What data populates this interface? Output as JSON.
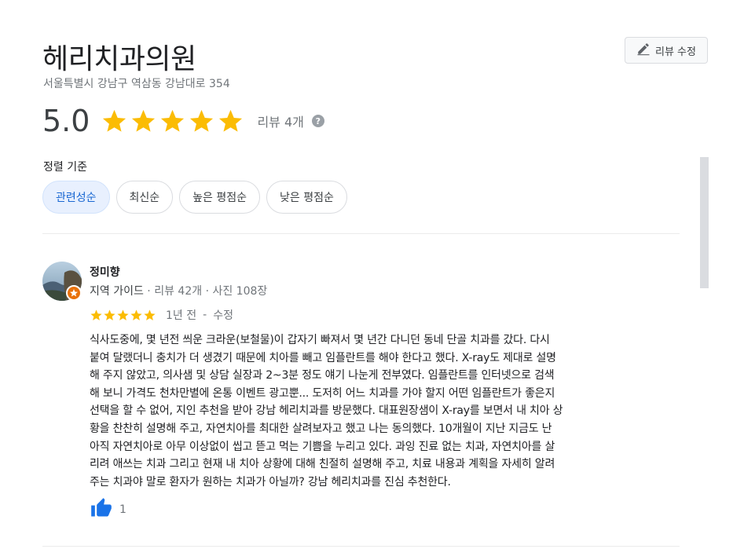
{
  "place": {
    "name": "헤리치과의원",
    "address": "서울특별시 강남구 역삼동 강남대로 354"
  },
  "edit_button": {
    "label": "리뷰 수정"
  },
  "summary": {
    "score": "5.0",
    "stars": 5,
    "review_count": "리뷰 4개",
    "help_icon": "?"
  },
  "sort": {
    "label": "정렬 기준",
    "options": [
      "관련성순",
      "최신순",
      "높은 평점순",
      "낮은 평점순"
    ],
    "selected": "관련성순"
  },
  "reviews": [
    {
      "author": "정미향",
      "guide_label": "지역 가이드",
      "stats": " · 리뷰 42개 · 사진 108장",
      "stars": 5,
      "date": "1년 전",
      "separator": "-",
      "edited": "수정",
      "text": "식사도중에, 몇 년전 씌운 크라운(보철물)이 갑자기 빠져서 몇 년간 다니던 동네 단골 치과를 갔다. 다시\n붙여 달랬더니 충치가 더 생겼기 때문에 치아를 빼고 임플란트를 해야 한다고 했다. X-ray도 제대로 설명\n해 주지 않았고, 의사샘 및 상담 실장과  2~3분 정도 얘기 나눈게 전부였다. 임플란트를 인터넷으로  검색\n해 보니 가격도 천차만별에 온통 이벤트 광고뿐... 도저히 어느 치과를 가야 할지 어떤 임플란트가 좋은지\n선택을 할 수 없어, 지인 추천을 받아 강남 헤리치과를 방문했다. 대표원장샘이 X-ray를 보면서 내 치아 상\n황을 찬찬히 설명해 주고, 자연치아를 최대한 살려보자고 했고 나는 동의했다. 10개월이 지난 지금도 난\n아직 자연치아로 아무 이상없이 씹고 뜯고 먹는 기쁨을 누리고 있다. 과잉 진료 없는 치과, 자연치아를 살\n리려 애쓰는 치과 그리고 현재 내 치아 상황에 대해 친절히 설명해 주고, 치료 내용과 계획을 자세히 알려\n주는 치과야 말로 환자가 원하는 치과가 아닐까? 강남 헤리치과를 진심 추천한다.",
      "likes": "1"
    }
  ],
  "colors": {
    "star": "#fbbc04",
    "chip_active_bg": "#e8f0fe",
    "chip_active_text": "#1967d2",
    "like": "#1a73e8",
    "guide_badge": "#e8710a"
  }
}
